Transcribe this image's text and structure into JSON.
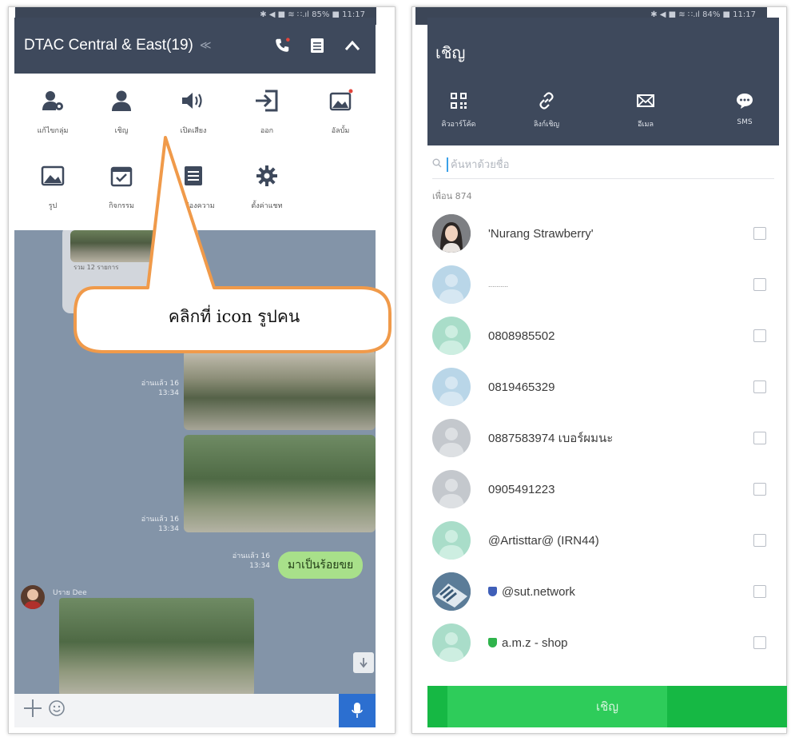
{
  "left": {
    "status_text": "✱ ◀ ■ ≋ ∷.ıl 85% ■ 11:17",
    "chat_title": "DTAC Central & East(19)",
    "mute_glyph": "≪",
    "menu_items": [
      {
        "label": "แก้ไขกลุ่ม",
        "icon": "person-gear-icon"
      },
      {
        "label": "เชิญ",
        "icon": "person-icon"
      },
      {
        "label": "เปิดเสียง",
        "icon": "speaker-icon"
      },
      {
        "label": "ออก",
        "icon": "exit-icon"
      },
      {
        "label": "อัลบั้ม",
        "icon": "album-icon"
      },
      {
        "label": "รูป",
        "icon": "photo-icon"
      },
      {
        "label": "กิจกรรม",
        "icon": "calendar-icon"
      },
      {
        "label": "การช่องความ",
        "icon": "list-icon"
      },
      {
        "label": "ตั้งค่าแชท",
        "icon": "gear-icon"
      }
    ],
    "chat": {
      "album_caption": "รวม 12 รายการ",
      "read_meta_1": "อ่านแล้ว 16",
      "time_1": "13:34",
      "read_meta_2": "อ่านแล้ว 16",
      "time_2": "13:34",
      "read_meta_3": "อ่านแล้ว 16",
      "time_3": "13:34",
      "green_message": "มาเป็นร้อยขย",
      "sender_name": "Uราย Dee"
    },
    "callout_text": "คลิกที่ icon รูปคน"
  },
  "right": {
    "status_text": "✱ ◀ ■ ≋ ∷.ıl 84% ■ 11:17",
    "title": "เชิญ",
    "options": [
      {
        "label": "คิวอาร์โค้ด",
        "icon": "qr-code-icon"
      },
      {
        "label": "ลิงก์เชิญ",
        "icon": "link-icon"
      },
      {
        "label": "อีเมล",
        "icon": "mail-icon"
      },
      {
        "label": "SMS",
        "icon": "sms-icon"
      }
    ],
    "search_placeholder": "ค้นหาด้วยชื่อ",
    "friends_count": "เพื่อน 874",
    "contacts": [
      {
        "name": "'Nurang Strawberry'",
        "avatar_color": "#6b6f74"
      },
      {
        "name": "..........",
        "avatar_color": "#b9d6e8"
      },
      {
        "name": "0808985502",
        "avatar_color": "#a9ddc9"
      },
      {
        "name": "0819465329",
        "avatar_color": "#b9d6e8"
      },
      {
        "name": "0887583974 เบอร์ผมนะ",
        "avatar_color": "#c4c8cd"
      },
      {
        "name": "0905491223",
        "avatar_color": "#c4c8cd"
      },
      {
        "name": "@Artisttar@ (IRN44)",
        "avatar_color": "#a9ddc9"
      },
      {
        "name": "@sut.network",
        "avatar_color": "#4f7090",
        "badge": "#3f5fb8"
      },
      {
        "name": "a.m.z - shop",
        "avatar_color": "#a9ddc9",
        "badge": "#2fb34c"
      }
    ],
    "invite_button": "เชิญ"
  }
}
